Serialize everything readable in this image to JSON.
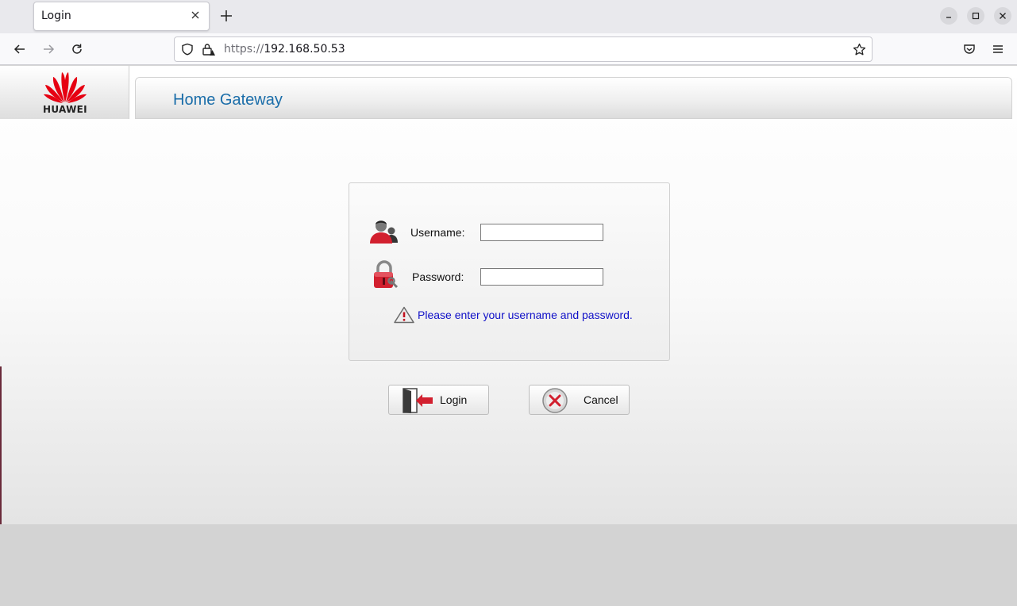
{
  "browser": {
    "tab_title": "Login",
    "url_scheme": "https://",
    "url_host": "192.168.50.53"
  },
  "header": {
    "logo_text": "HUAWEI",
    "title": "Home Gateway"
  },
  "login_form": {
    "username_label": "Username:",
    "username_value": "",
    "password_label": "Password:",
    "password_value": "",
    "message": "Please enter your username and password."
  },
  "buttons": {
    "login_label": "Login",
    "cancel_label": "Cancel"
  },
  "colors": {
    "header_title": "#1a6da9",
    "message_text": "#1010c8",
    "brand_red": "#e60012"
  }
}
